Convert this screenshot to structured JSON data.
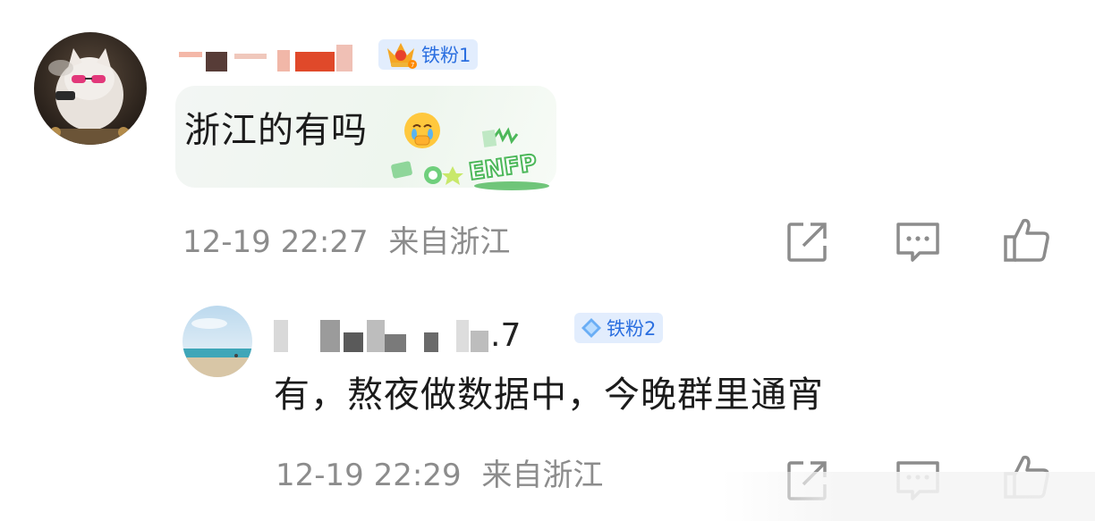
{
  "comment": {
    "badge_label": "铁粉1",
    "text": "浙江的有吗",
    "sticker_label": "ENFP",
    "timestamp": "12-19 22:27",
    "location": "来自浙江"
  },
  "reply": {
    "username_suffix": ".7",
    "badge_label": "铁粉2",
    "text": "有，熬夜做数据中，今晚群里通宵",
    "timestamp": "12-19 22:29",
    "location": "来自浙江"
  },
  "icons": {
    "share": "share-icon",
    "comment": "comment-icon",
    "like": "thumbs-up-icon",
    "badge_gold": "crown-icon",
    "badge_blue": "diamond-icon",
    "emoji": "crying-face-emoji-icon"
  },
  "colors": {
    "badge_text": "#2b6fe0",
    "badge_bg": "#e2edfd",
    "meta_text": "#8c8c8c",
    "body_text": "#1b1b1b"
  }
}
